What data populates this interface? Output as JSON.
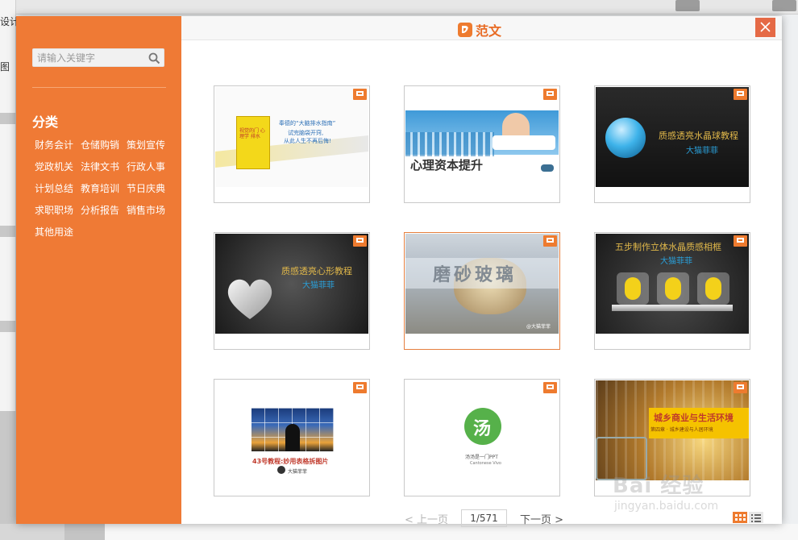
{
  "background": {
    "top_left_label": "设计",
    "left_label": "图"
  },
  "dialog": {
    "title": "范文",
    "close_label": "×"
  },
  "sidebar": {
    "search_placeholder": "请输入关键字",
    "category_title": "分类",
    "categories": [
      "财务会计",
      "仓储购销",
      "策划宣传",
      "党政机关",
      "法律文书",
      "行政人事",
      "计划总结",
      "教育培训",
      "节日庆典",
      "求职职场",
      "分析报告",
      "销售市场",
      "其他用途"
    ]
  },
  "cards": [
    {
      "line1": "奉德的“大脑排水指南”",
      "line2": "试完脑袋开窍,",
      "line3": "从此人生不再后悔!",
      "book": "视觉的门 心理学 排水"
    },
    {
      "title": "心理资本提升"
    },
    {
      "title": "质感透亮水晶球教程",
      "author": "大猫菲菲"
    },
    {
      "title": "质感透亮心形教程",
      "author": "大猫菲菲"
    },
    {
      "title": "磨砂玻璃",
      "author": "@大猫菲菲"
    },
    {
      "title": "五步制作立体水晶质感相框",
      "author": "大猫菲菲"
    },
    {
      "title": "43号教程:妙用表格拆图片",
      "author": "大猫菲菲"
    },
    {
      "logo_char": "汤",
      "subtitle": "汤汤是一门PPT",
      "en": "Cantonese Vivo"
    },
    {
      "title": "城乡商业与生活环境",
      "sub": "第四章 · 城乡建设与人居环境"
    }
  ],
  "pager": {
    "prev": "< 上一页",
    "page": "1/571",
    "next": "下一页 >"
  },
  "watermark": {
    "main": "Bai 经验",
    "sub": "jingyan.baidu.com"
  },
  "colors": {
    "accent": "#ef7a35",
    "close": "#e56a46"
  }
}
